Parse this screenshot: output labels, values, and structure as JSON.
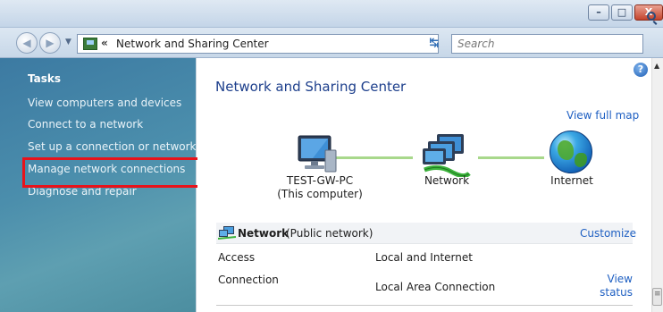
{
  "window": {
    "minimize_glyph": "–",
    "maximize_glyph": "□",
    "close_glyph": "X"
  },
  "address_bar": {
    "separator": "«",
    "path": "Network and Sharing Center",
    "search_placeholder": "Search"
  },
  "sidebar": {
    "title": "Tasks",
    "items": [
      {
        "label": "View computers and devices"
      },
      {
        "label": "Connect to a network"
      },
      {
        "label": "Set up a connection or network"
      },
      {
        "label": "Manage network connections",
        "highlighted": true
      },
      {
        "label": "Diagnose and repair"
      }
    ]
  },
  "main": {
    "title": "Network and Sharing Center",
    "view_full_map": "View full map",
    "map": {
      "computer_name": "TEST-GW-PC",
      "computer_note": "(This computer)",
      "network_label": "Network",
      "internet_label": "Internet"
    },
    "network_section": {
      "name": "Network",
      "type": "(Public network)",
      "customize": "Customize",
      "rows": [
        {
          "label": "Access",
          "value": "Local and Internet"
        },
        {
          "label": "Connection",
          "value": "Local Area Connection"
        }
      ],
      "view_status": "View status"
    }
  },
  "colors": {
    "sidebar_top": "#3c7aa2",
    "sidebar_bottom": "#4c8ea0",
    "link": "#1e5fc2",
    "title": "#1d3f8c",
    "highlight_box": "#e8131b",
    "map_line": "#a8d88b"
  },
  "icons": [
    "back-icon",
    "forward-icon",
    "network-folder-icon",
    "refresh-icon",
    "search-icon",
    "help-icon",
    "computer-monitor-icon",
    "network-icon",
    "globe-icon"
  ]
}
